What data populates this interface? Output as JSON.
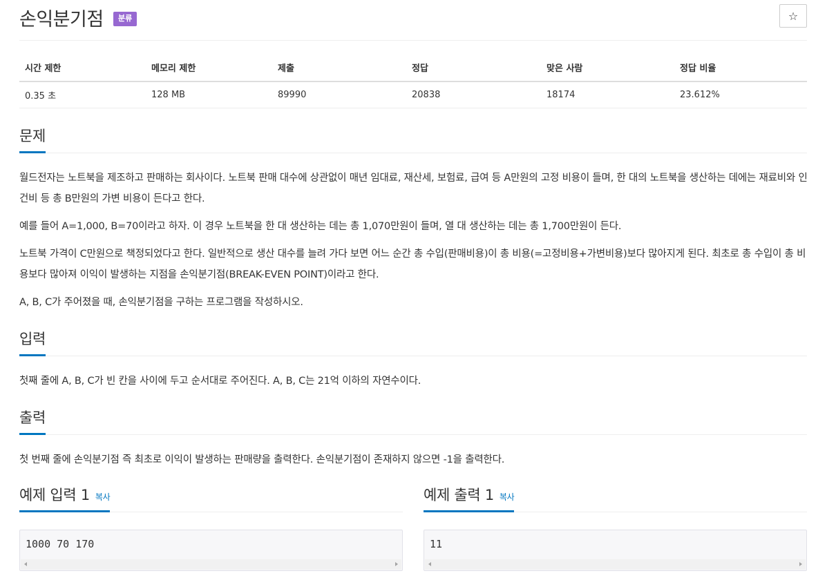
{
  "problem": {
    "title": "손익분기점",
    "tag_label": "분류",
    "star_icon": "☆"
  },
  "info_table": {
    "headers": [
      "시간 제한",
      "메모리 제한",
      "제출",
      "정답",
      "맞은 사람",
      "정답 비율"
    ],
    "values": [
      "0.35 초",
      "128 MB",
      "89990",
      "20838",
      "18174",
      "23.612%"
    ]
  },
  "sections": {
    "problem_heading": "문제",
    "problem_paragraphs": [
      "월드전자는 노트북을 제조하고 판매하는 회사이다. 노트북 판매 대수에 상관없이 매년 임대료, 재산세, 보험료, 급여 등 A만원의 고정 비용이 들며, 한 대의 노트북을 생산하는 데에는 재료비와 인건비 등 총 B만원의 가변 비용이 든다고 한다.",
      "예를 들어 A=1,000, B=70이라고 하자. 이 경우 노트북을 한 대 생산하는 데는 총 1,070만원이 들며, 열 대 생산하는 데는 총 1,700만원이 든다.",
      "노트북 가격이 C만원으로 책정되었다고 한다. 일반적으로 생산 대수를 늘려 가다 보면 어느 순간 총 수입(판매비용)이 총 비용(=고정비용+가변비용)보다 많아지게 된다. 최초로 총 수입이 총 비용보다 많아져 이익이 발생하는 지점을 손익분기점(BREAK-EVEN POINT)이라고 한다.",
      "A, B, C가 주어졌을 때, 손익분기점을 구하는 프로그램을 작성하시오."
    ],
    "input_heading": "입력",
    "input_text": "첫째 줄에 A, B, C가 빈 칸을 사이에 두고 순서대로 주어진다. A, B, C는 21억 이하의 자연수이다.",
    "output_heading": "출력",
    "output_text": "첫 번째 줄에 손익분기점 즉 최초로 이익이 발생하는 판매량을 출력한다. 손익분기점이 존재하지 않으면 -1을 출력한다."
  },
  "samples": {
    "input_heading": "예제 입력 1",
    "output_heading": "예제 출력 1",
    "copy_label": "복사",
    "input_value": "1000 70 170",
    "output_value": "11"
  }
}
